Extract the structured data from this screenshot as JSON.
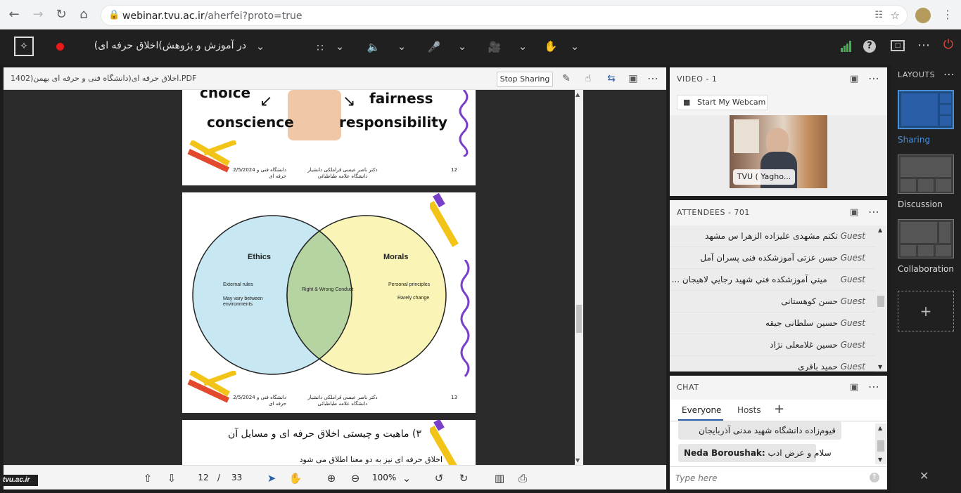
{
  "browser": {
    "url_host": "webinar.tvu.ac.ir",
    "url_path": "/aherfei?proto=true"
  },
  "app": {
    "meeting_title": "در آموزش و پژوهش)اخلاق حرفه ای)",
    "accent": "#2a5ea8",
    "record_color": "#e81a1a"
  },
  "share": {
    "doc_title": "1402)اخلاق حرفه ای(دانشگاه فنی و حرفه ای بهمن.PDF",
    "stop_sharing": "Stop Sharing",
    "page_current": "12",
    "page_sep": "/",
    "page_total": "33",
    "zoom": "100%",
    "watermark": "tvu.ac.ir"
  },
  "slide12": {
    "word_choice": "choice",
    "word_fairness": "fairness",
    "word_conscience": "conscience",
    "word_responsibility": "responsibility",
    "footer_left": "دانشگاه فنی و 2/5/2024 حرفه ای",
    "footer_mid": "دکتر ناصر عیسی قراملکی دانشیار دانشگاه علامه طباطبائی",
    "page_no": "12"
  },
  "slide13": {
    "ethics": "Ethics",
    "morals": "Morals",
    "external_rules": "External rules",
    "may_vary": "May vary between environments",
    "right_wrong": "Right & Wrong Conduct",
    "personal_principles": "Personal principles",
    "rarely_change": "Rarely change",
    "footer_left": "دانشگاه فنی و 2/5/2024 حرفه ای",
    "footer_mid": "دکتر ناصر عیسی قراملکی دانشیار دانشگاه علامه طباطبائی",
    "page_no": "13"
  },
  "slide14": {
    "heading": "۳) ماهیت و چیستی اخلاق حرفه ای و مسایل آن",
    "line1": "اخلاق حرفه ای نیز به دو معنا اطلاق می شود"
  },
  "video": {
    "title": "VIDEO",
    "count": "- 1",
    "start_webcam": "Start My Webcam",
    "cam_label": "TVU ( Yagho..."
  },
  "attendees": {
    "title": "ATTENDEES",
    "count": "- 701",
    "list": [
      {
        "role": "Guest",
        "name": "تکتم مشهدی علیزاده الزهرا س مشهد"
      },
      {
        "role": "Guest",
        "name": "حسن عزتی آموزشکده فنی پسران آمل"
      },
      {
        "role": "Guest",
        "name": "ميني آموزشكده فني شهيد رجايي لاهيجان ..."
      },
      {
        "role": "Guest",
        "name": "حسن کوهستانی"
      },
      {
        "role": "Guest",
        "name": "حسین سلطانی جیقه"
      },
      {
        "role": "Guest",
        "name": "حسین غلامعلی نژاد"
      },
      {
        "role": "Guest",
        "name": "حمید باقری"
      }
    ]
  },
  "chat": {
    "title": "CHAT",
    "tab_everyone": "Everyone",
    "tab_hosts": "Hosts",
    "msg1": "قیوم‌زاده دانشگاه شهید مدنی آذربایجان",
    "msg2_sender": "Neda Boroushak:",
    "msg2_text": "سلام و عرض ادب",
    "input_placeholder": "Type here"
  },
  "layouts": {
    "title": "LAYOUTS",
    "sharing": "Sharing",
    "discussion": "Discussion",
    "collaboration": "Collaboration",
    "add": "+"
  }
}
